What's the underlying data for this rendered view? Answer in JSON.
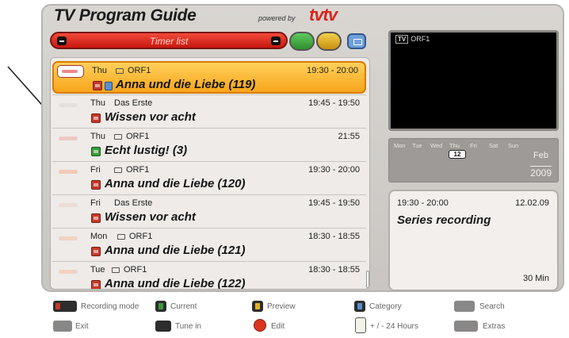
{
  "header": {
    "title": "TV Program Guide",
    "powered_by": "powered by",
    "logo": "tvtv"
  },
  "timer_bar": {
    "label": "Timer list"
  },
  "color_buttons": {
    "green": "#3aa83a",
    "yellow": "#e4b320",
    "blue_cam": "#6fa0d9"
  },
  "program_list": [
    {
      "day": "Thu",
      "channel": "ORF1",
      "time": "19:30 - 20:00",
      "title": "Anna und die Liebe (119)",
      "selected": true,
      "rec": "red"
    },
    {
      "day": "Thu",
      "channel": "Das Erste",
      "time": "19:45 - 19:50",
      "title": "Wissen vor acht",
      "rec": "red"
    },
    {
      "day": "Thu",
      "channel": "ORF1",
      "time": "21:55",
      "title": "Echt lustig! (3)",
      "rec": "green"
    },
    {
      "day": "Fri",
      "channel": "ORF1",
      "time": "19:30 - 20:00",
      "title": "Anna und die Liebe (120)",
      "rec": "red"
    },
    {
      "day": "Fri",
      "channel": "Das Erste",
      "time": "19:45 - 19:50",
      "title": "Wissen vor acht",
      "rec": "red"
    },
    {
      "day": "Mon",
      "channel": "ORF1",
      "time": "18:30 - 18:55",
      "title": "Anna und die Liebe (121)",
      "rec": "red"
    },
    {
      "day": "Tue",
      "channel": "ORF1",
      "time": "18:30 - 18:55",
      "title": "Anna und die Liebe (122)",
      "rec": "red"
    }
  ],
  "preview": {
    "channel_tag": "ORF1"
  },
  "calendar": {
    "weekdays": [
      "Mon",
      "Tue",
      "Wed",
      "Thu",
      "Fri",
      "Sat",
      "Sun"
    ],
    "today": "12",
    "month": "Feb",
    "year": "2009"
  },
  "detail": {
    "time": "19:30 - 20:00",
    "date": "12.02.09",
    "status": "Series recording",
    "duration": "30 Min"
  },
  "legend": {
    "recording_mode": "Recording mode",
    "current": "Current",
    "preview": "Preview",
    "category": "Category",
    "search": "Search",
    "exit": "Exit",
    "tune_in": "Tune in",
    "edit": "Edit",
    "hours": "+ / - 24 Hours",
    "extras": "Extras"
  }
}
